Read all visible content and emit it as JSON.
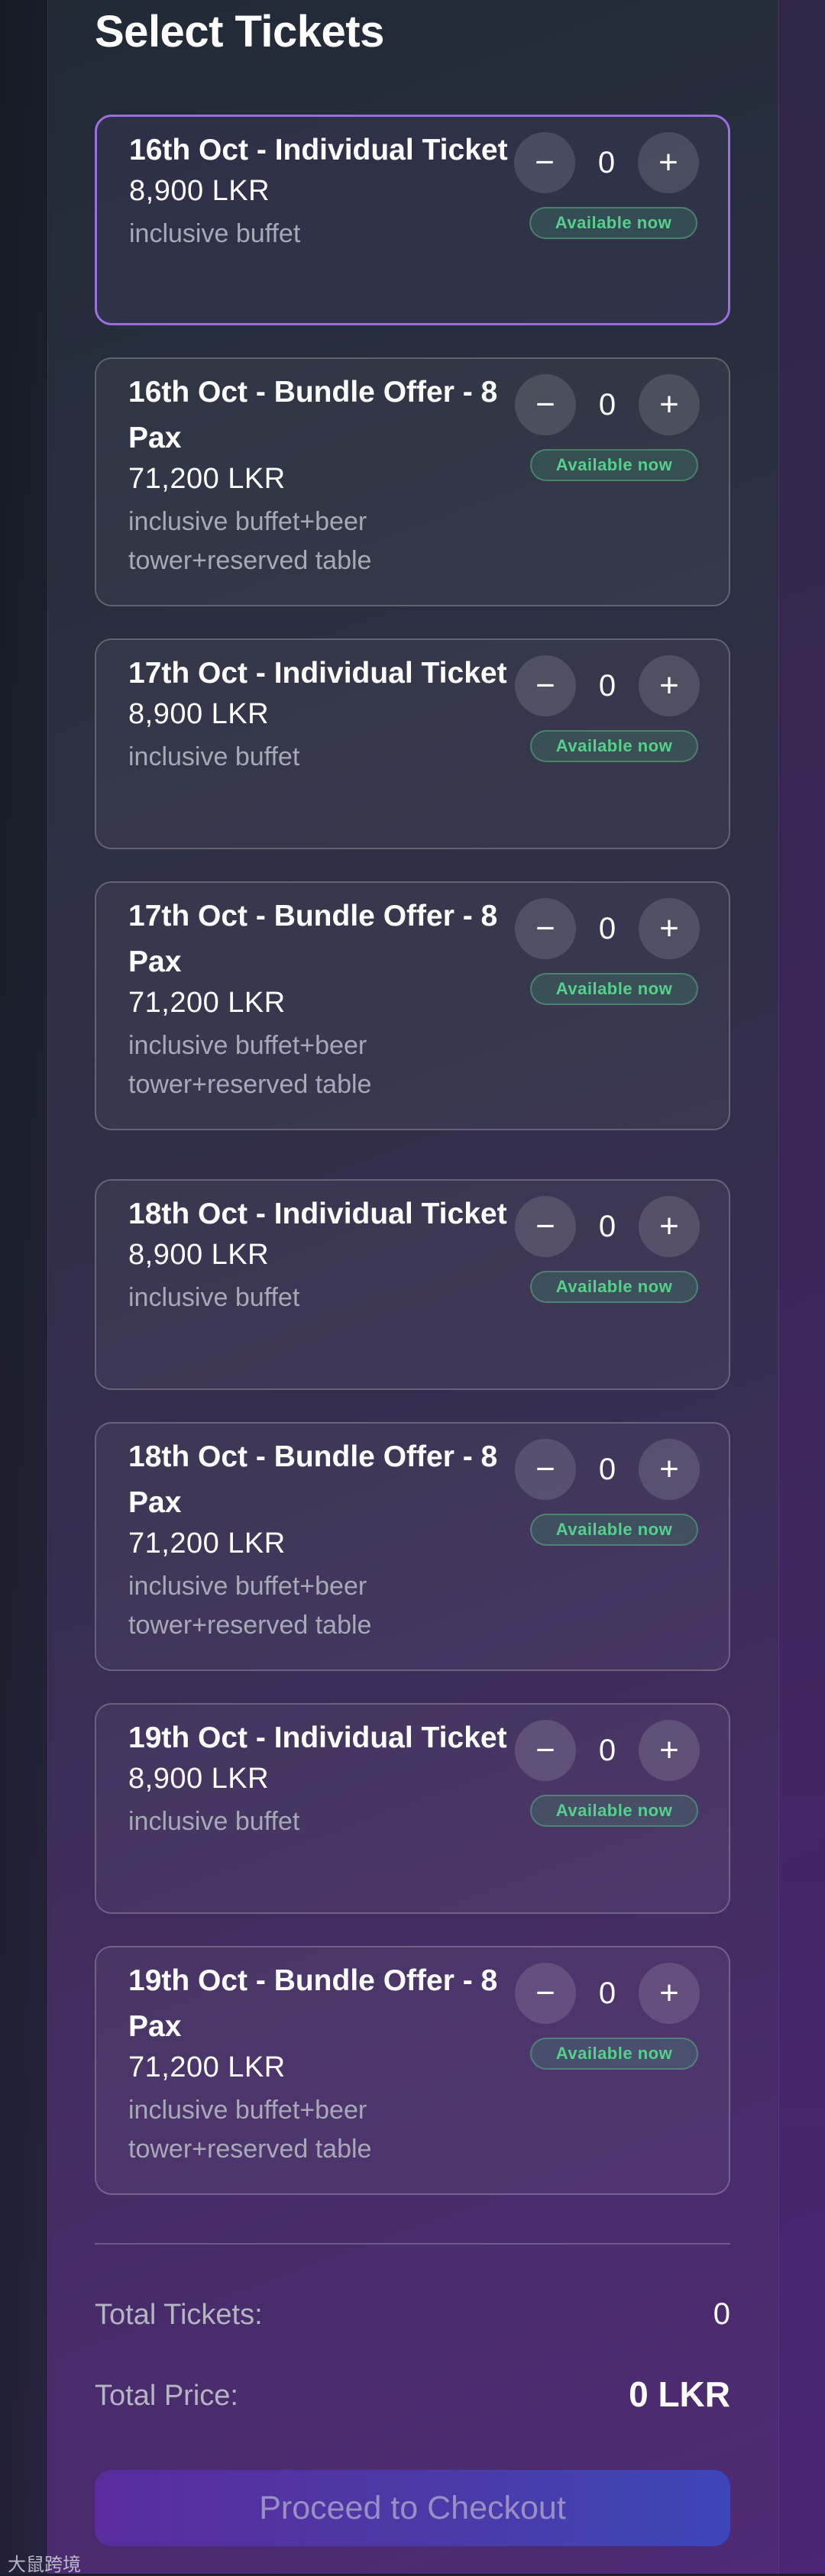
{
  "page": {
    "title": "Select Tickets"
  },
  "tickets": [
    {
      "name": "16th Oct - Individual Ticket",
      "price": "8,900 LKR",
      "desc": "inclusive buffet",
      "qty": "0",
      "status": "Available now",
      "selected": true
    },
    {
      "name": "16th Oct - Bundle Offer - 8 Pax",
      "price": "71,200 LKR",
      "desc": "inclusive buffet+beer tower+reserved table",
      "qty": "0",
      "status": "Available now",
      "selected": false
    },
    {
      "name": "17th Oct - Individual Ticket",
      "price": "8,900 LKR",
      "desc": "inclusive buffet",
      "qty": "0",
      "status": "Available now",
      "selected": false
    },
    {
      "name": "17th Oct - Bundle Offer - 8 Pax",
      "price": "71,200 LKR",
      "desc": "inclusive buffet+beer tower+reserved table",
      "qty": "0",
      "status": "Available now",
      "selected": false
    },
    {
      "name": "18th Oct - Individual Ticket",
      "price": "8,900 LKR",
      "desc": "inclusive buffet",
      "qty": "0",
      "status": "Available now",
      "selected": false
    },
    {
      "name": "18th Oct - Bundle Offer - 8 Pax",
      "price": "71,200 LKR",
      "desc": "inclusive buffet+beer tower+reserved table",
      "qty": "0",
      "status": "Available now",
      "selected": false
    },
    {
      "name": "19th Oct - Individual Ticket",
      "price": "8,900 LKR",
      "desc": "inclusive buffet",
      "qty": "0",
      "status": "Available now",
      "selected": false
    },
    {
      "name": "19th Oct - Bundle Offer - 8 Pax",
      "price": "71,200 LKR",
      "desc": "inclusive buffet+beer tower+reserved table",
      "qty": "0",
      "status": "Available now",
      "selected": false
    }
  ],
  "stepper": {
    "minus_icon": "minus-icon",
    "plus_icon": "plus-icon",
    "minus_glyph": "−",
    "plus_glyph": "+"
  },
  "summary": {
    "total_tickets_label": "Total Tickets:",
    "total_tickets_value": "0",
    "total_price_label": "Total Price:",
    "total_price_value": "0 LKR"
  },
  "checkout": {
    "label": "Proceed to Checkout"
  },
  "watermark": {
    "text": "大鼠跨境"
  },
  "colors": {
    "accent": "#9b6ee0",
    "status_green": "#56d08c",
    "checkout_start": "#5a2c9c",
    "checkout_end": "#3c46b8"
  }
}
